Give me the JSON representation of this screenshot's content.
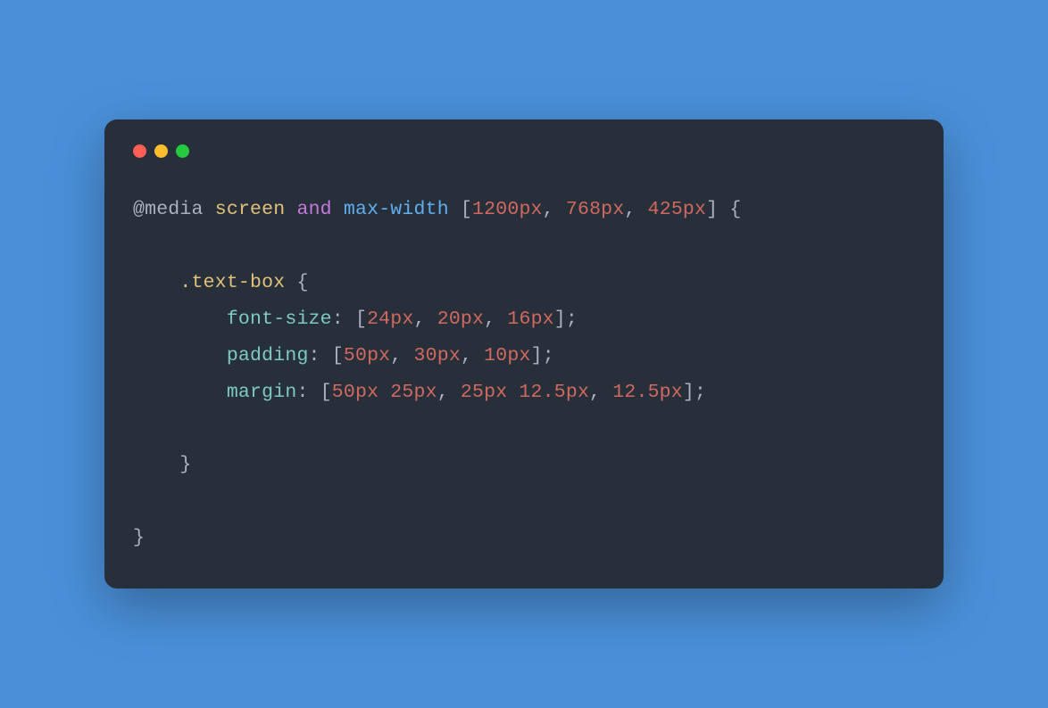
{
  "code": {
    "line1": {
      "at": "@media",
      "screen": "screen",
      "and": "and",
      "maxwidth": "max-width",
      "open_bracket": "[",
      "v1": "1200px",
      "c1": ", ",
      "v2": "768px",
      "c2": ", ",
      "v3": "425px",
      "close_bracket": "]",
      "open_brace": " {"
    },
    "blank1": "",
    "line3": {
      "indent": "    ",
      "selector": ".text-box",
      "open_brace": " {"
    },
    "line4": {
      "indent": "        ",
      "prop": "font-size",
      "colon": ": ",
      "ob": "[",
      "v1": "24px",
      "c1": ", ",
      "v2": "20px",
      "c2": ", ",
      "v3": "16px",
      "cb": "]",
      "semi": ";"
    },
    "line5": {
      "indent": "        ",
      "prop": "padding",
      "colon": ": ",
      "ob": "[",
      "v1": "50px",
      "c1": ", ",
      "v2": "30px",
      "c2": ", ",
      "v3": "10px",
      "cb": "]",
      "semi": ";"
    },
    "line6": {
      "indent": "        ",
      "prop": "margin",
      "colon": ": ",
      "ob": "[",
      "v1": "50px 25px",
      "c1": ", ",
      "v2": "25px 12.5px",
      "c2": ", ",
      "v3": "12.5px",
      "cb": "]",
      "semi": ";"
    },
    "blank2": "",
    "line8": {
      "indent": "    ",
      "close_brace": "}"
    },
    "blank3": "",
    "line10": {
      "close_brace": "}"
    }
  }
}
